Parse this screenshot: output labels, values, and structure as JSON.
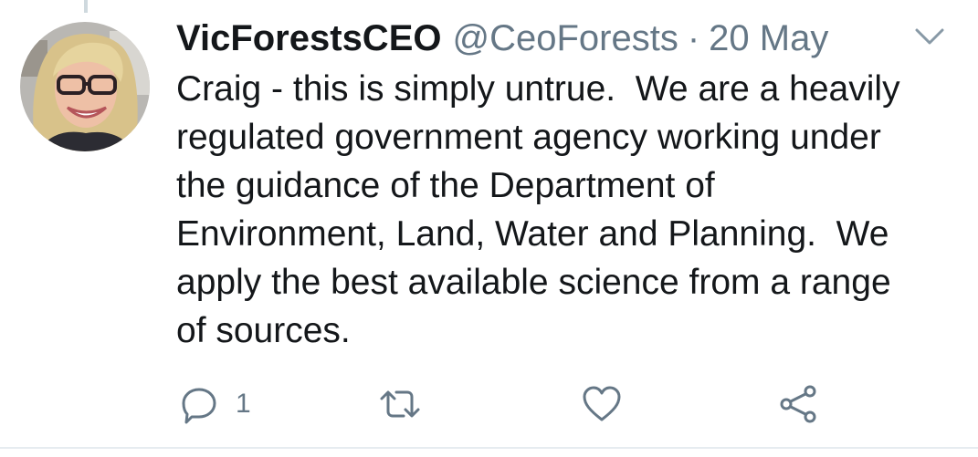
{
  "tweet": {
    "display_name": "VicForestsCEO",
    "handle": "@CeoForests",
    "separator": "·",
    "date": "20 May",
    "text": "Craig - this is simply untrue.  We are a heavily\nregulated government agency working under\nthe guidance of the Department of\nEnvironment, Land, Water and Planning.  We\napply the best available science from a range\nof sources."
  },
  "actions": {
    "reply_count": "1",
    "reply_icon": "reply-icon",
    "retweet_icon": "retweet-icon",
    "like_icon": "heart-icon",
    "share_icon": "share-icon",
    "menu_icon": "chevron-down-icon"
  },
  "colors": {
    "text_primary": "#14171a",
    "text_secondary": "#657786",
    "divider": "#e6ecf0",
    "icon": "#657786"
  }
}
